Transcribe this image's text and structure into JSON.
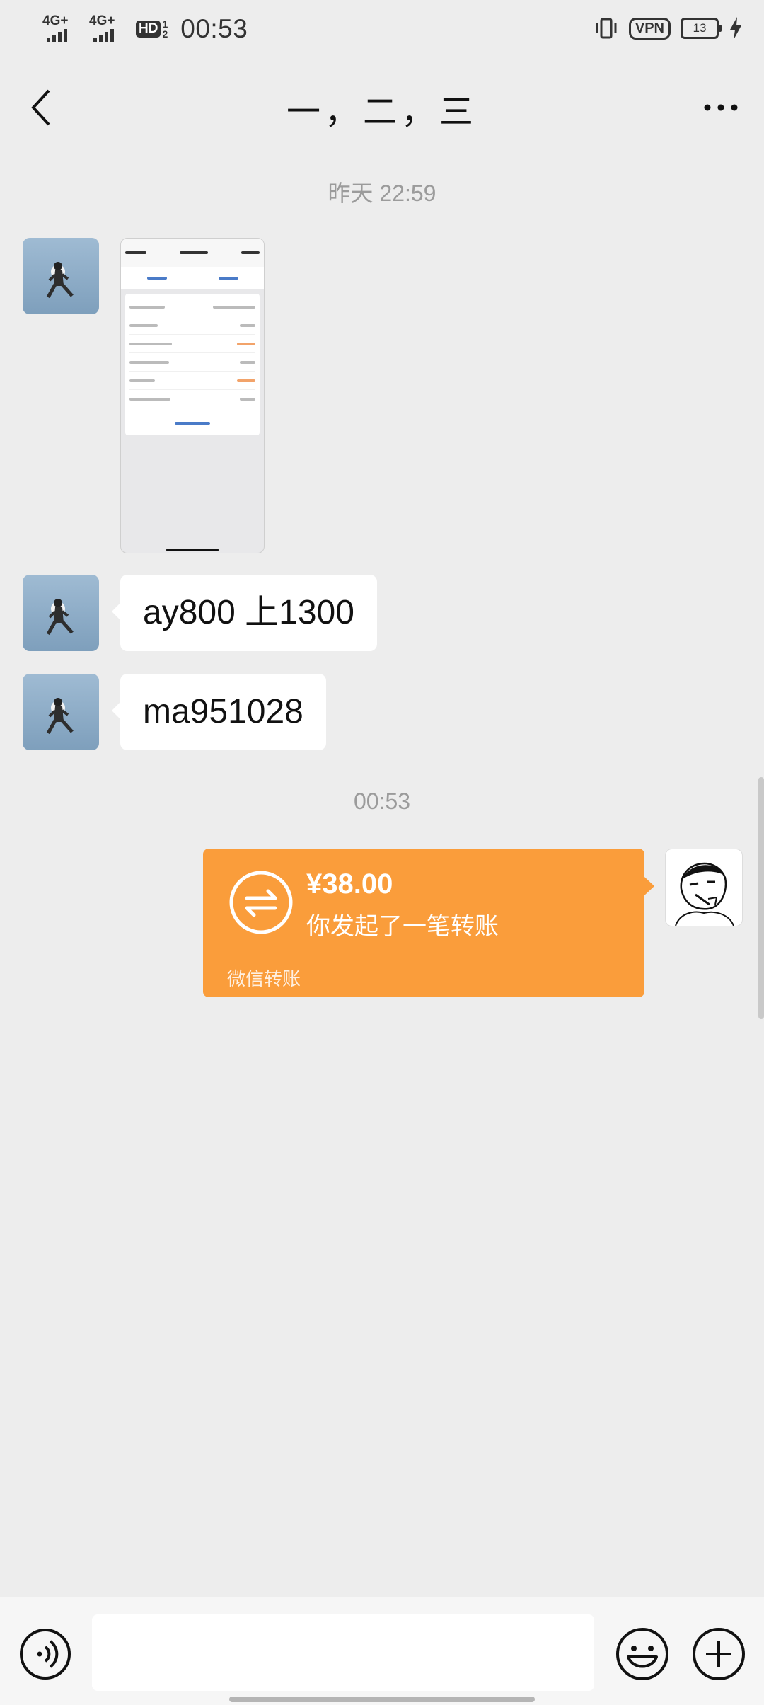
{
  "status_bar": {
    "signal1": "4G+",
    "signal2": "4G+",
    "hd": "HD",
    "hd_sup": "1",
    "hd_sub": "2",
    "time": "00:53",
    "vpn": "VPN",
    "battery": "13"
  },
  "nav": {
    "title": "一，二，三",
    "back_icon": "chevron-left-icon",
    "more_icon": "more-dots-icon"
  },
  "messages": {
    "timestamp1": "昨天 22:59",
    "text1": "ay800 上1300",
    "text2": "ma951028",
    "timestamp2": "00:53"
  },
  "transfer": {
    "amount": "¥38.00",
    "description": "你发起了一笔转账",
    "footer": "微信转账",
    "color": "#fa9d3b"
  },
  "input_bar": {
    "voice_icon": "voice-icon",
    "emoji_icon": "emoji-icon",
    "plus_icon": "plus-icon"
  }
}
